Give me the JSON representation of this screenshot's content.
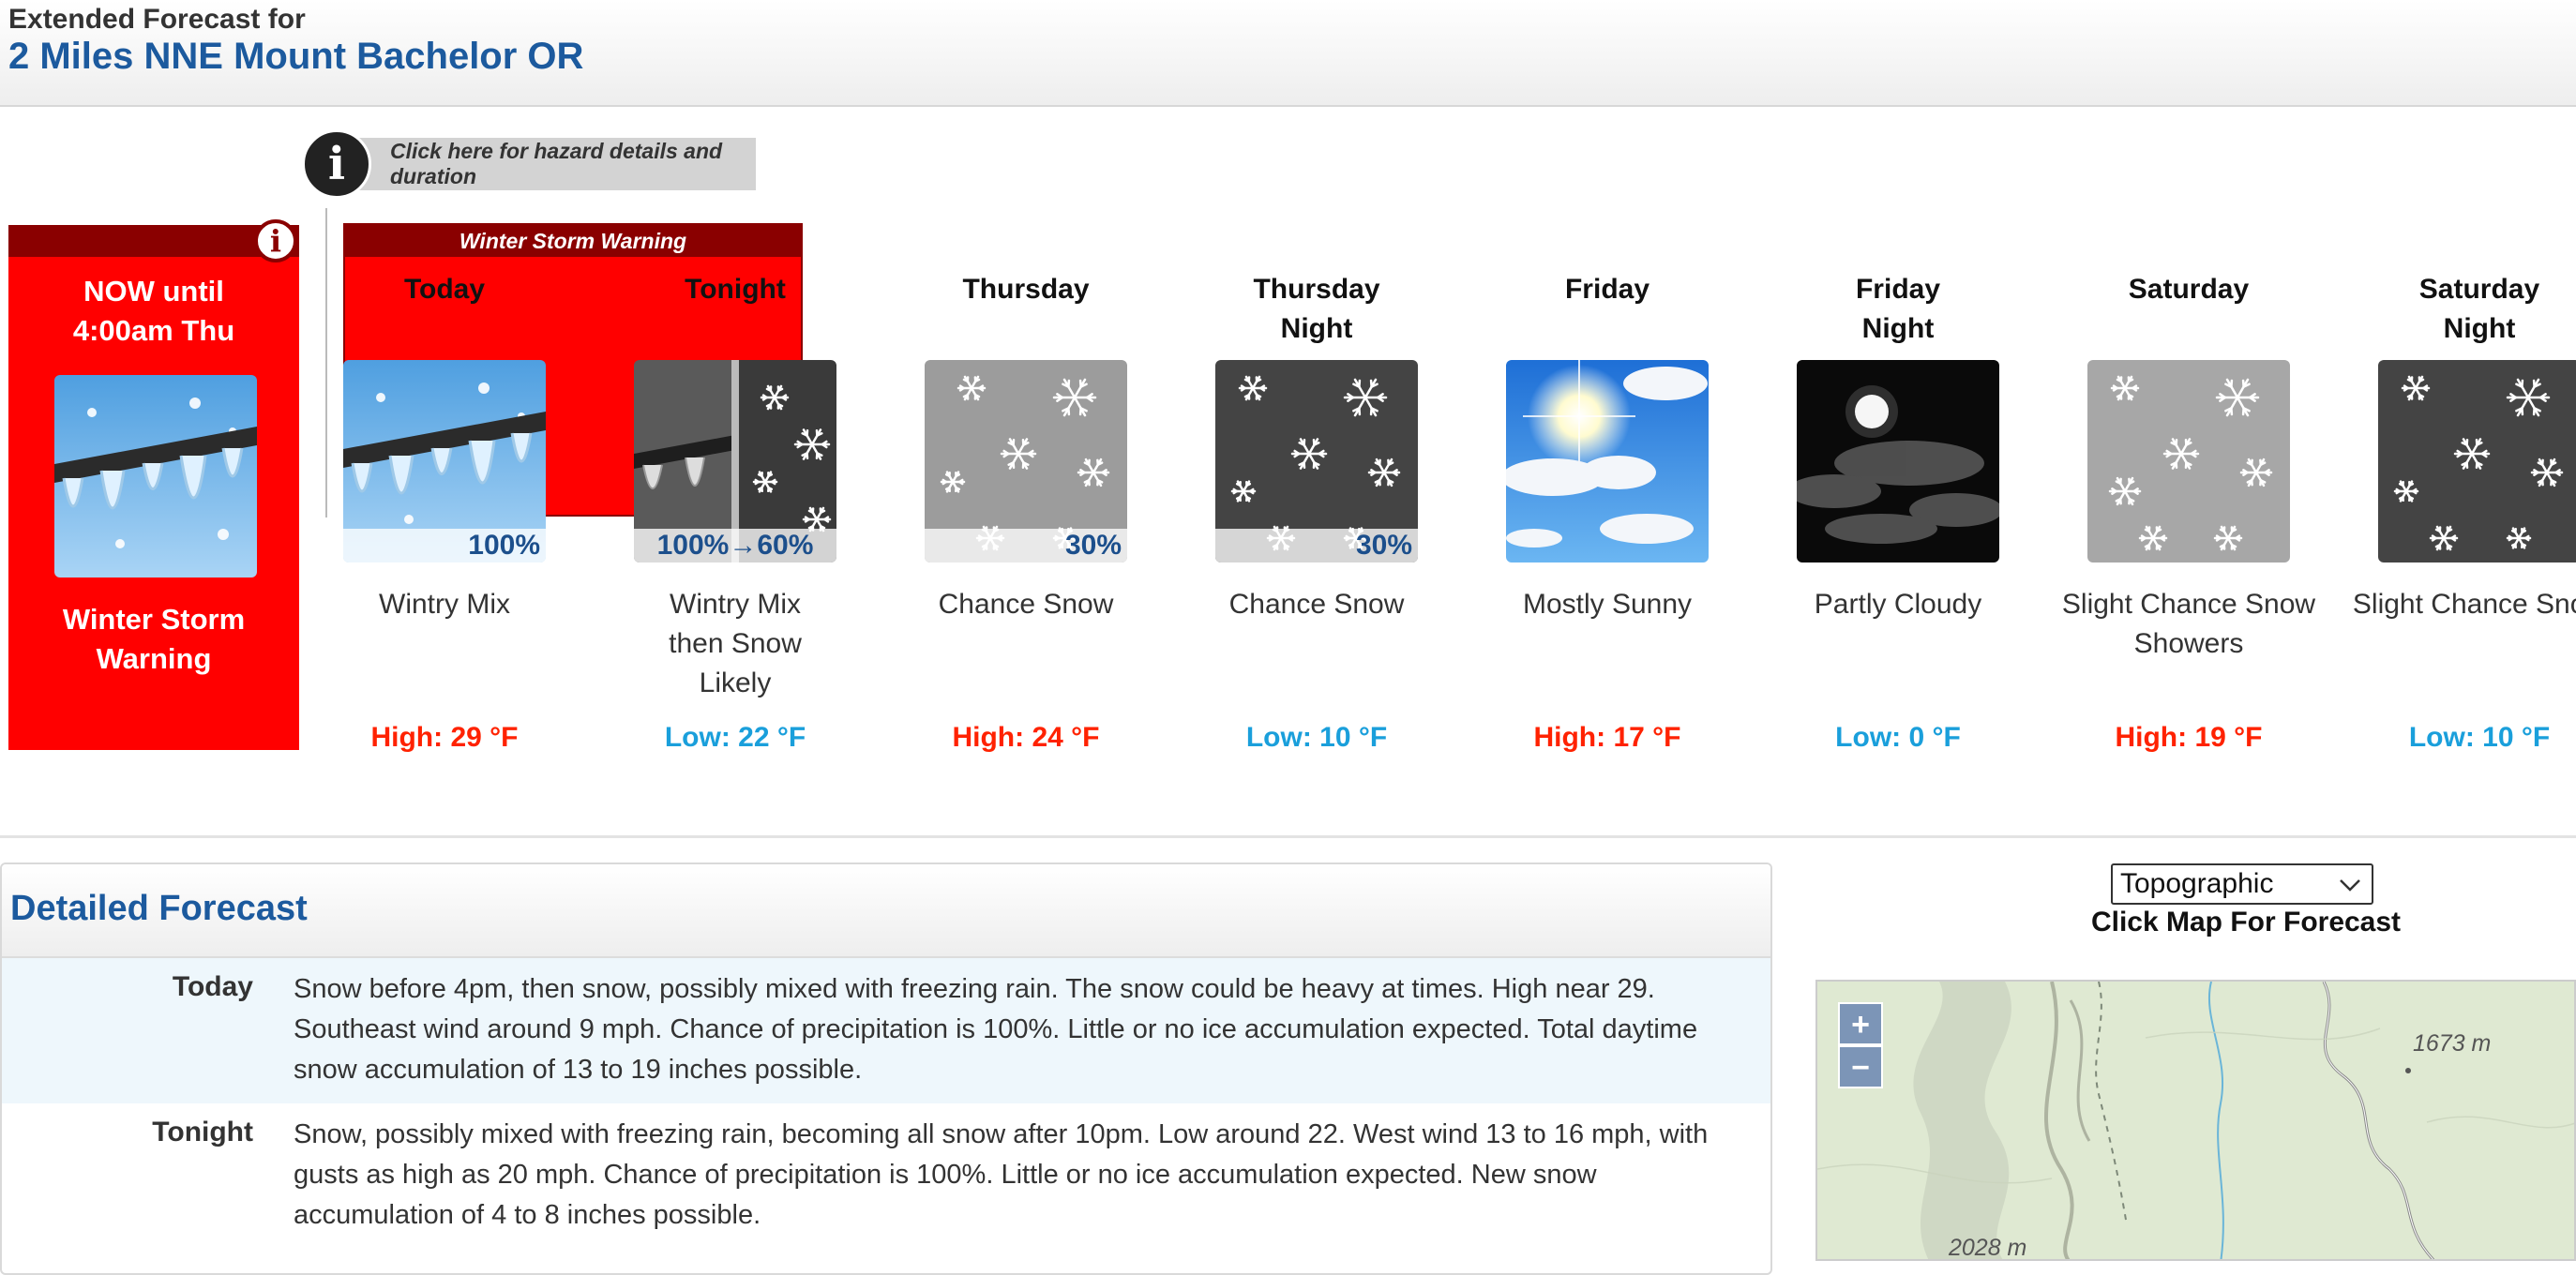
{
  "header": {
    "subtitle": "Extended Forecast for",
    "location": "2 Miles NNE Mount Bachelor OR"
  },
  "hazard_link": {
    "info_glyph": "i",
    "label": "Click here for hazard details and duration"
  },
  "now_box": {
    "until": "NOW until\n4:00am Thu",
    "warning": "Winter Storm\nWarning",
    "icon": "wintry-mix-icon"
  },
  "warning_banner": {
    "title": "Winter Storm Warning"
  },
  "periods": [
    {
      "name": "Today",
      "icon": "wintry-mix-icon",
      "pop": "100%",
      "desc": "Wintry Mix",
      "temp": "High: 29 °F",
      "kind": "hi"
    },
    {
      "name": "Tonight",
      "icon": "wintry-mix-then-snow-icon",
      "pop": "100%→60%",
      "desc": "Wintry Mix then Snow Likely",
      "temp": "Low: 22 °F",
      "kind": "lo"
    },
    {
      "name": "Thursday",
      "icon": "snow-day-icon",
      "pop": "30%",
      "desc": "Chance Snow",
      "temp": "High: 24 °F",
      "kind": "hi"
    },
    {
      "name": "Thursday Night",
      "icon": "snow-night-icon",
      "pop": "30%",
      "desc": "Chance Snow",
      "temp": "Low: 10 °F",
      "kind": "lo"
    },
    {
      "name": "Friday",
      "icon": "mostly-sunny-icon",
      "pop": "",
      "desc": "Mostly Sunny",
      "temp": "High: 17 °F",
      "kind": "hi"
    },
    {
      "name": "Friday Night",
      "icon": "partly-cloudy-night-icon",
      "pop": "",
      "desc": "Partly Cloudy",
      "temp": "Low: 0 °F",
      "kind": "lo"
    },
    {
      "name": "Saturday",
      "icon": "snow-showers-day-icon",
      "pop": "",
      "desc": "Slight Chance Snow Showers",
      "temp": "High: 19 °F",
      "kind": "hi"
    },
    {
      "name": "Saturday Night",
      "icon": "snow-night-icon",
      "pop": "",
      "desc": "Slight Chance Snow",
      "temp": "Low: 10 °F",
      "kind": "lo"
    }
  ],
  "detailed": {
    "heading": "Detailed Forecast",
    "rows": [
      {
        "label": "Today",
        "text": "Snow before 4pm, then snow, possibly mixed with freezing rain. The snow could be heavy at times. High near 29. Southeast wind around 9 mph. Chance of precipitation is 100%. Little or no ice accumulation expected. Total daytime snow accumulation of 13 to 19 inches possible."
      },
      {
        "label": "Tonight",
        "text": "Snow, possibly mixed with freezing rain, becoming all snow after 10pm. Low around 22. West wind 13 to 16 mph, with gusts as high as 20 mph. Chance of precipitation is 100%. Little or no ice accumulation expected. New snow accumulation of 4 to 8 inches possible."
      }
    ]
  },
  "map": {
    "select_value": "Topographic",
    "caption": "Click Map For Forecast",
    "zoom_in": "+",
    "zoom_out": "−",
    "elev_label_1": "1673 m",
    "elev_label_2": "2028 m"
  },
  "colors": {
    "hazard_red": "#ff0000",
    "hazard_dark_red": "#8a0000",
    "high_temp": "#ff2200",
    "low_temp": "#1a9fdb",
    "title_blue": "#1c5a9e"
  }
}
